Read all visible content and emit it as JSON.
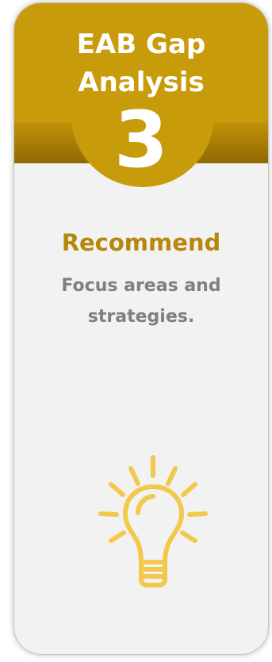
{
  "card": {
    "title": "EAB Gap Analysis",
    "step_number": "3",
    "section_title": "Recommend",
    "description": "Focus areas and strategies."
  },
  "icon": {
    "name": "lightbulb-icon"
  },
  "colors": {
    "gold": "#c89b0a",
    "gold_dark": "#8f6a03",
    "title_gold": "#b8860b",
    "text_gray": "#808080",
    "card_bg": "#f2f2f2",
    "bulb_yellow": "#f2c94c"
  }
}
